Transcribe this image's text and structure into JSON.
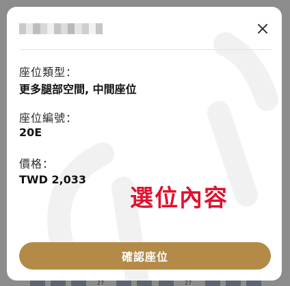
{
  "dialog": {
    "seat_type_label": "座位類型：",
    "seat_type_value": "更多腿部空間, 中間座位",
    "seat_number_label": "座位編號：",
    "seat_number_value": "20E",
    "price_label": "價格：",
    "price_value": "TWD 2,033",
    "annotation_text": "選位內容",
    "confirm_label": "確認座位"
  },
  "colors": {
    "accent_button": "#b48a49",
    "annotation": "#e3102d",
    "backdrop": "#8c8c8c",
    "close_icon": "#333333"
  },
  "icons": {
    "close": "close-icon"
  },
  "backdrop_seats": [
    "27",
    "27"
  ]
}
